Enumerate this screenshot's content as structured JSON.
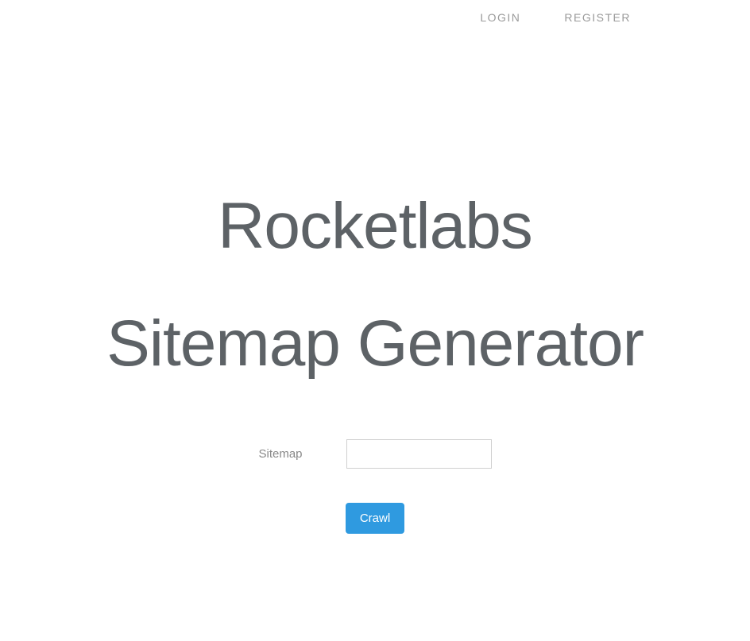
{
  "nav": {
    "login": "LOGIN",
    "register": "REGISTER"
  },
  "title": {
    "line1": "Rocketlabs",
    "line2": "Sitemap Generator"
  },
  "form": {
    "label": "Sitemap",
    "input_value": "",
    "button_label": "Crawl"
  }
}
